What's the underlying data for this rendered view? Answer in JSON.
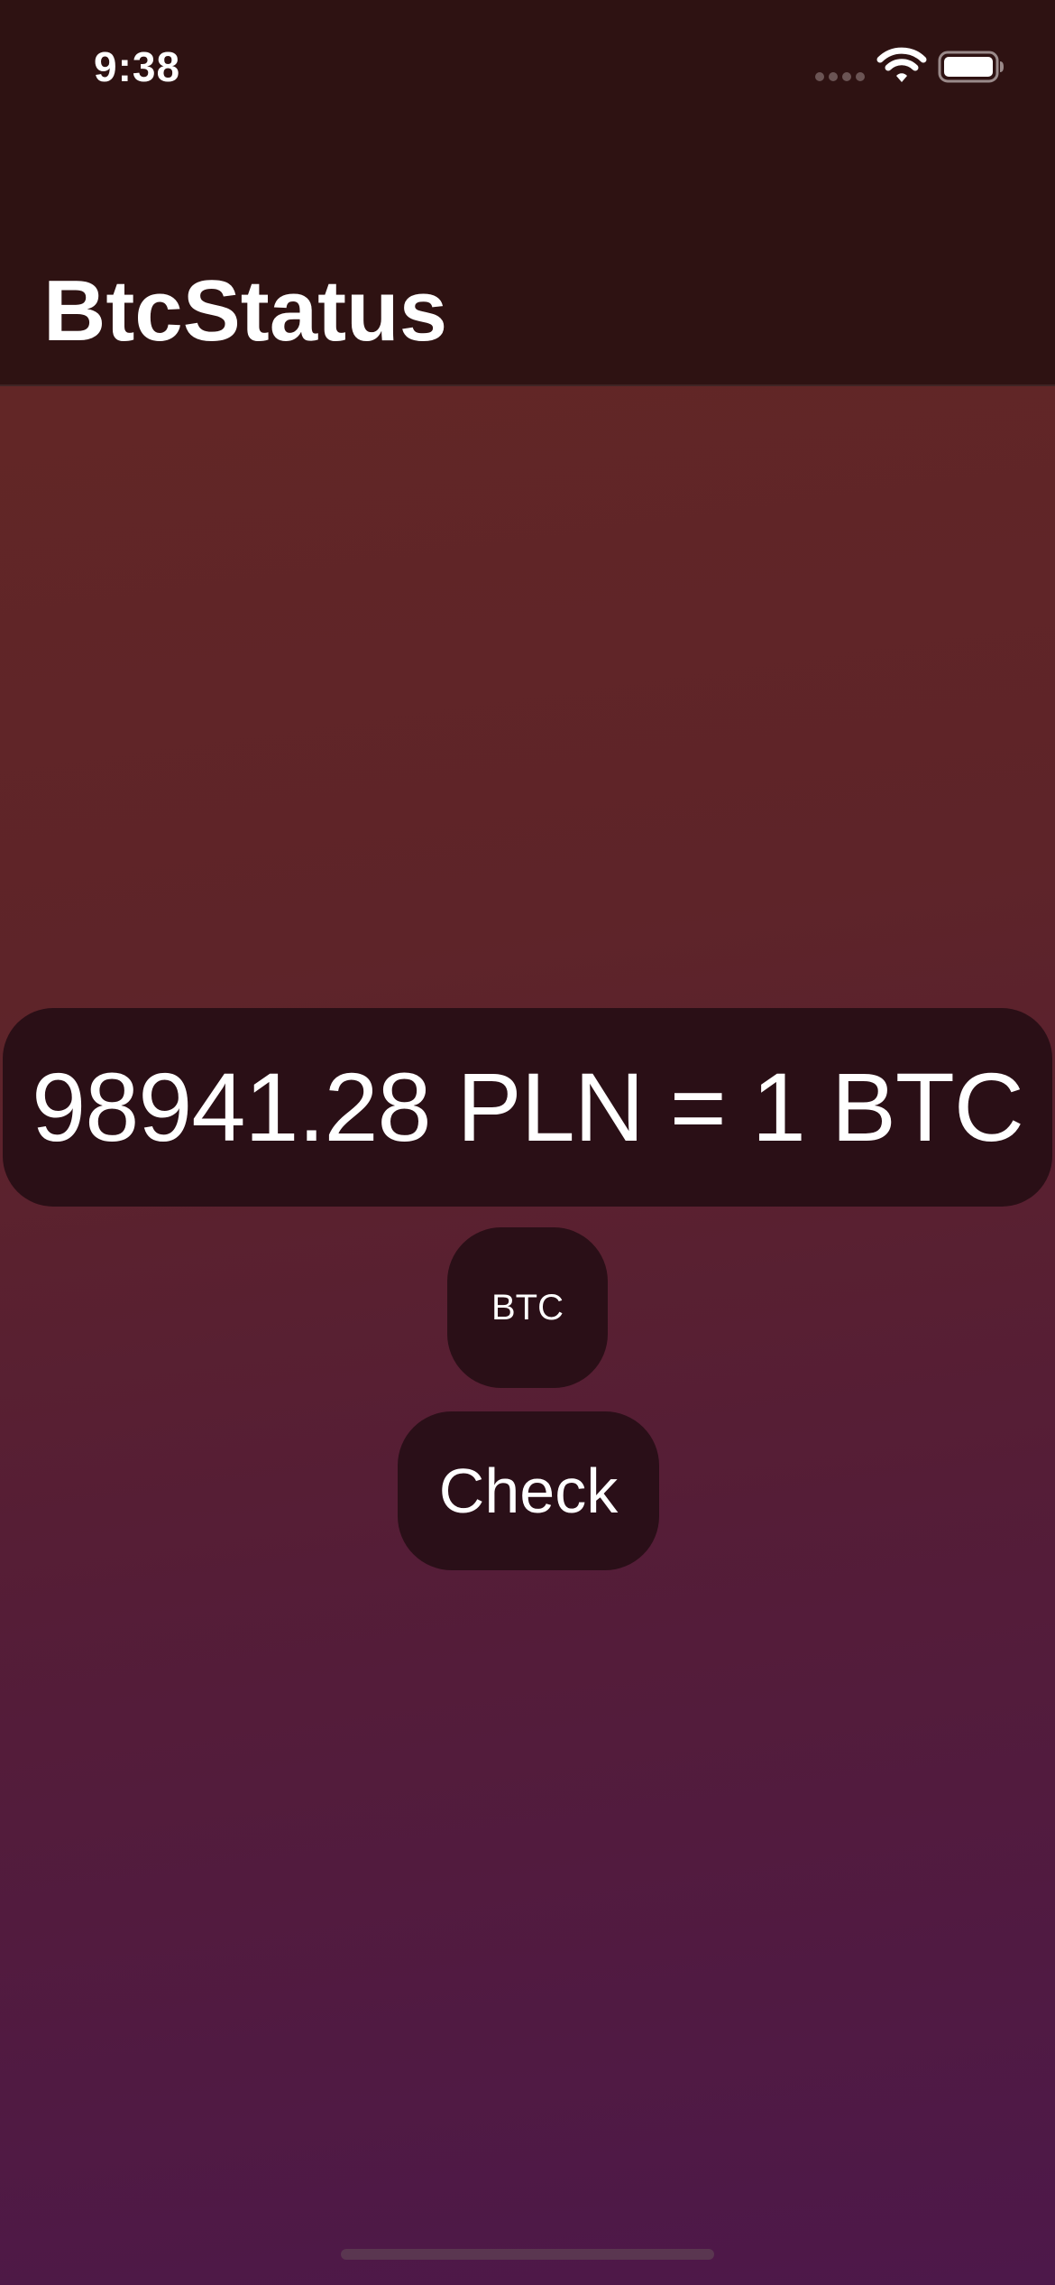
{
  "status_bar": {
    "time": "9:38",
    "icons": [
      "signal-dots-icon",
      "wifi-icon",
      "battery-icon"
    ]
  },
  "nav": {
    "title": "BtcStatus"
  },
  "main": {
    "rate_text": "98941.28 PLN = 1 BTC",
    "currency_button_label": "BTC",
    "check_button_label": "Check"
  },
  "colors": {
    "bar_background": "#2e1212",
    "gradient_top": "#622626",
    "gradient_bottom": "#4d184a",
    "panel": "#2a0f16",
    "text": "#ffffff"
  }
}
